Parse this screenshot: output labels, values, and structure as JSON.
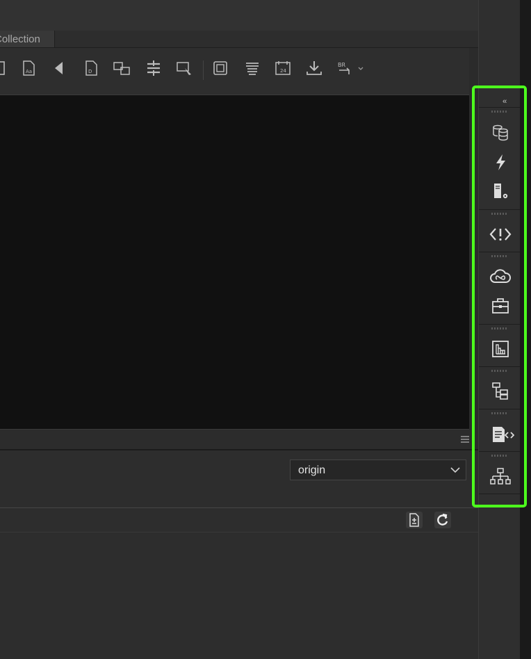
{
  "tabs": {
    "active_label": "Collection"
  },
  "toolbar": {
    "icons": [
      "page-icon",
      "text-file-icon",
      "triangle-left-icon",
      "document-icon",
      "link-files-icon",
      "align-icon",
      "cursor-select-icon",
      "frame-icon",
      "stack-icon",
      "calendar-icon",
      "download-icon",
      "br-sync-icon"
    ]
  },
  "branch_select": {
    "value": "origin"
  },
  "dock": {
    "collapse_label": "‹‹",
    "icons": [
      "databases-icon",
      "lightning-icon",
      "server-settings-icon",
      "code-warning-icon",
      "creative-cloud-icon",
      "toolbox-icon",
      "building-chart-icon",
      "tree-structure-icon",
      "document-code-icon",
      "sitemap-icon"
    ]
  },
  "colors": {
    "highlight": "#4dff1d",
    "canvas": "#111111",
    "panel": "#2d2d2d"
  }
}
